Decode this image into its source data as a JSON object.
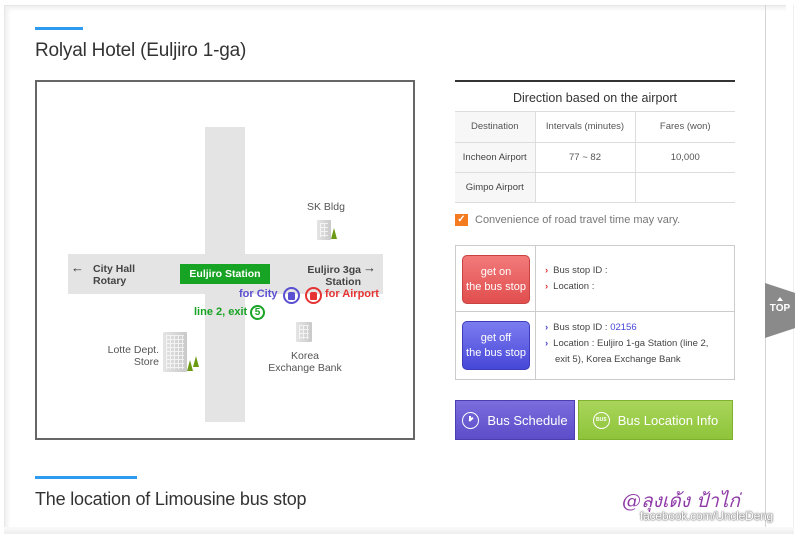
{
  "hotel_section": {
    "title": "Rolyal Hotel (Euljiro 1-ga)"
  },
  "map": {
    "station": "Euljiro Station",
    "left_destination": [
      "City Hall",
      "Rotary"
    ],
    "right_destination": [
      "Euljiro 3ga",
      "Station"
    ],
    "for_city": "for City",
    "for_airport": "for Airport",
    "exit_label": "line 2, exit",
    "exit_number": "5",
    "landmarks": {
      "sk": "SK Bldg",
      "lotte": [
        "Lotte Dept.",
        "Store"
      ],
      "keb": [
        "Korea",
        "Exchange Bank"
      ]
    },
    "colors": {
      "station": "#17a323",
      "city": "#5a4fd0",
      "airport": "#e53333"
    }
  },
  "direction": {
    "title": "Direction based on the airport",
    "headers": [
      "Destination",
      "Intervals (minutes)",
      "Fares (won)"
    ],
    "rows": [
      {
        "destination": "Incheon Airport",
        "interval": "77 ~ 82",
        "fare": "10,000"
      },
      {
        "destination": "Gimpo Airport",
        "interval": "",
        "fare": ""
      }
    ],
    "notice": "Convenience of road travel time may vary."
  },
  "bus_stops": {
    "get_on": {
      "button": [
        "get on",
        "the bus stop"
      ],
      "id_label": "Bus stop ID :",
      "id_value": "",
      "location_label": "Location :",
      "location_value": ""
    },
    "get_off": {
      "button": [
        "get off",
        "the bus stop"
      ],
      "id_label": "Bus stop ID :",
      "id_value": "02156",
      "location_label": "Location :",
      "location_value": "Euljiro 1-ga Station (line 2,",
      "location_value_cont": "exit 5), Korea Exchange Bank"
    }
  },
  "actions": {
    "schedule": "Bus Schedule",
    "location": "Bus Location Info"
  },
  "top_button": "TOP",
  "limousine_section": {
    "title": "The location of Limousine bus stop"
  },
  "watermark": {
    "thai": "@ลุงเด้ง ป้าไก่",
    "url": "facebook.com/UncleDeng"
  }
}
